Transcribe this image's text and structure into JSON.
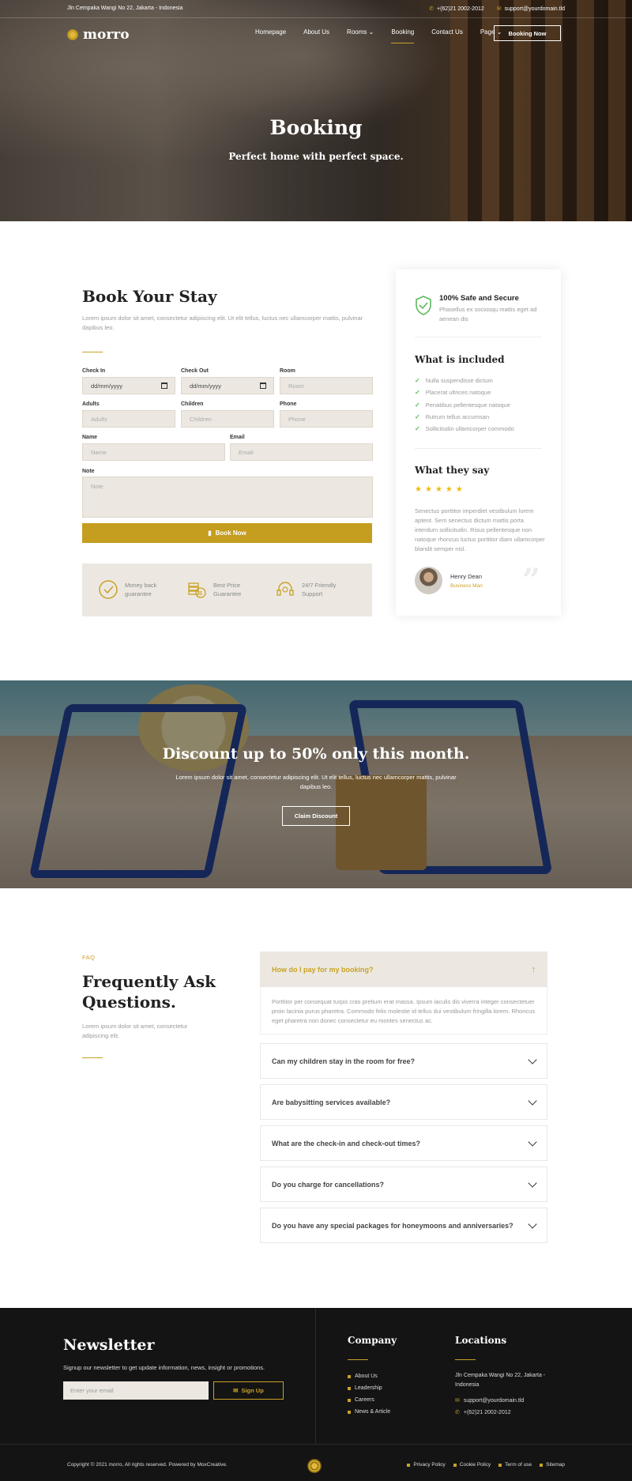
{
  "topbar": {
    "address": "Jln Cempaka Wangi No 22, Jakarta - Indonesia",
    "phone": "+(62)21 2002-2012",
    "email": "support@yourdomain.tld"
  },
  "brand": {
    "name": "morro"
  },
  "nav": {
    "items": [
      "Homepage",
      "About Us",
      "Rooms",
      "Booking",
      "Contact Us",
      "Page"
    ],
    "active": "Booking",
    "cta": "Booking Now"
  },
  "hero": {
    "title": "Booking",
    "subtitle": "Perfect home with perfect space."
  },
  "booking": {
    "title": "Book Your Stay",
    "description": "Lorem ipsum dolor sit amet, consectetur adipiscing elit. Ut elit tellus, luctus nec ullamcorper mattis, pulvinar dapibus leo.",
    "fields": {
      "checkin": {
        "label": "Check In",
        "value": "dd/mm/yyyy"
      },
      "checkout": {
        "label": "Check Out",
        "value": "dd/mm/yyyy"
      },
      "room": {
        "label": "Room",
        "placeholder": "Room"
      },
      "adults": {
        "label": "Adults",
        "placeholder": "Adults"
      },
      "children": {
        "label": "Children",
        "placeholder": "Children"
      },
      "phone": {
        "label": "Phone",
        "placeholder": "Phone"
      },
      "name": {
        "label": "Name",
        "placeholder": "Name"
      },
      "email": {
        "label": "Email",
        "placeholder": "Email"
      },
      "note": {
        "label": "Note",
        "placeholder": "Note"
      }
    },
    "submit": "Book Now",
    "features": [
      {
        "line1": "Money back",
        "line2": "guarantee"
      },
      {
        "line1": "Best Price",
        "line2": "Guarantee"
      },
      {
        "line1": "24/7 Friendly",
        "line2": "Support"
      }
    ]
  },
  "sidebar": {
    "safe_title": "100% Safe and Secure",
    "safe_desc": "Phasellus ex sociosqu mattis eget ad aenean dis",
    "included_title": "What is included",
    "included": [
      "Nulla suspendisse dictum",
      "Placerat ultrices natoque",
      "Penatibus pellentesque natoque",
      "Rutrum tellus accumsan",
      "Sollicitudin ullamcorper commodo"
    ],
    "testimonial_title": "What they say",
    "rating": 5,
    "quote": "Senectus porttitor imperdiet vestibulum lorem aptent. Sem senectus dictum mattis porta interdum sollicitudin. Risus pellentesque non natoque rhoncus luctus porttitor diam ullamcorper blandit semper nisl.",
    "reviewer_name": "Henry Dean",
    "reviewer_role": "Business Man"
  },
  "discount": {
    "title": "Discount up to 50% only this month.",
    "description": "Lorem ipsum dolor sit amet, consectetur adipiscing elit. Ut elit tellus, luctus nec ullamcorper mattis, pulvinar dapibus leo.",
    "cta": "Claim Discount"
  },
  "faq": {
    "tag": "FAQ",
    "title": "Frequently Ask Questions.",
    "description": "Lorem ipsum dolor sit amet, consectetur adipiscing elit.",
    "open_question": "How do I pay for my booking?",
    "open_answer": "Porttitor per consequat turpis cras pretium erat massa. Ipsum iaculis dis viverra integer consectetuer proin lacinia purus pharetra. Commodo felis molestie id tellus dui vestibulum fringilla lorem. Rhoncus eget pharetra non donec consectetur eu montes senectus ac.",
    "questions": [
      "Can my children stay in the room for free?",
      "Are babysitting services available?",
      "What are the check-in and check-out times?",
      "Do you charge for cancellations?",
      "Do you have any special packages for honeymoons and anniversaries?"
    ]
  },
  "footer": {
    "newsletter_title": "Newsletter",
    "newsletter_desc": "Signup our newsletter to get update information, news, insight or promotions.",
    "newsletter_placeholder": "Enter your email",
    "newsletter_button": "Sign Up",
    "company_title": "Company",
    "company_links": [
      "About Us",
      "Leadership",
      "Careers",
      "News & Article"
    ],
    "locations_title": "Locations",
    "location_address": "Jln Cempaka Wangi No 22, Jakarta - Indonesia",
    "location_email": "support@yourdomain.tld",
    "location_phone": "+(62)21 2002-2012",
    "copyright": "Copyright © 2021 morro, All rights reserved. Powered by MoxCreative.",
    "legal_links": [
      "Privacy Policy",
      "Cookie Policy",
      "Term of use",
      "Sitemap"
    ]
  },
  "colors": {
    "accent": "#c9a227",
    "dark": "#141414",
    "field": "#ece8e1"
  }
}
